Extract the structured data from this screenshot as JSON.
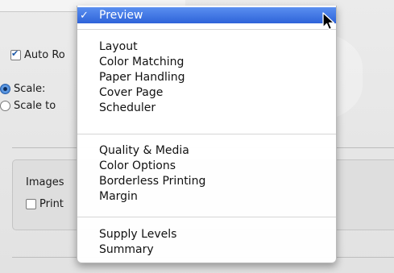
{
  "dialog": {
    "auto_rotate_label": "Auto Ro",
    "auto_rotate_checked": true,
    "scale_label": "Scale:",
    "scale_to_label": "Scale to",
    "images_group_label": "Images",
    "print_label": "Print"
  },
  "menu": {
    "selected": "Preview",
    "items": [
      {
        "label": "Preview",
        "checked": true
      },
      {
        "label": "Layout"
      },
      {
        "label": "Color Matching"
      },
      {
        "label": "Paper Handling"
      },
      {
        "label": "Cover Page"
      },
      {
        "label": "Scheduler"
      },
      {
        "label": "Quality & Media"
      },
      {
        "label": "Color Options"
      },
      {
        "label": "Borderless Printing"
      },
      {
        "label": "Margin"
      },
      {
        "label": "Supply Levels"
      },
      {
        "label": "Summary"
      }
    ],
    "check_glyph": "✓"
  },
  "colors": {
    "highlight": "#2e63d9",
    "radio_selected": "#3f82d6"
  }
}
